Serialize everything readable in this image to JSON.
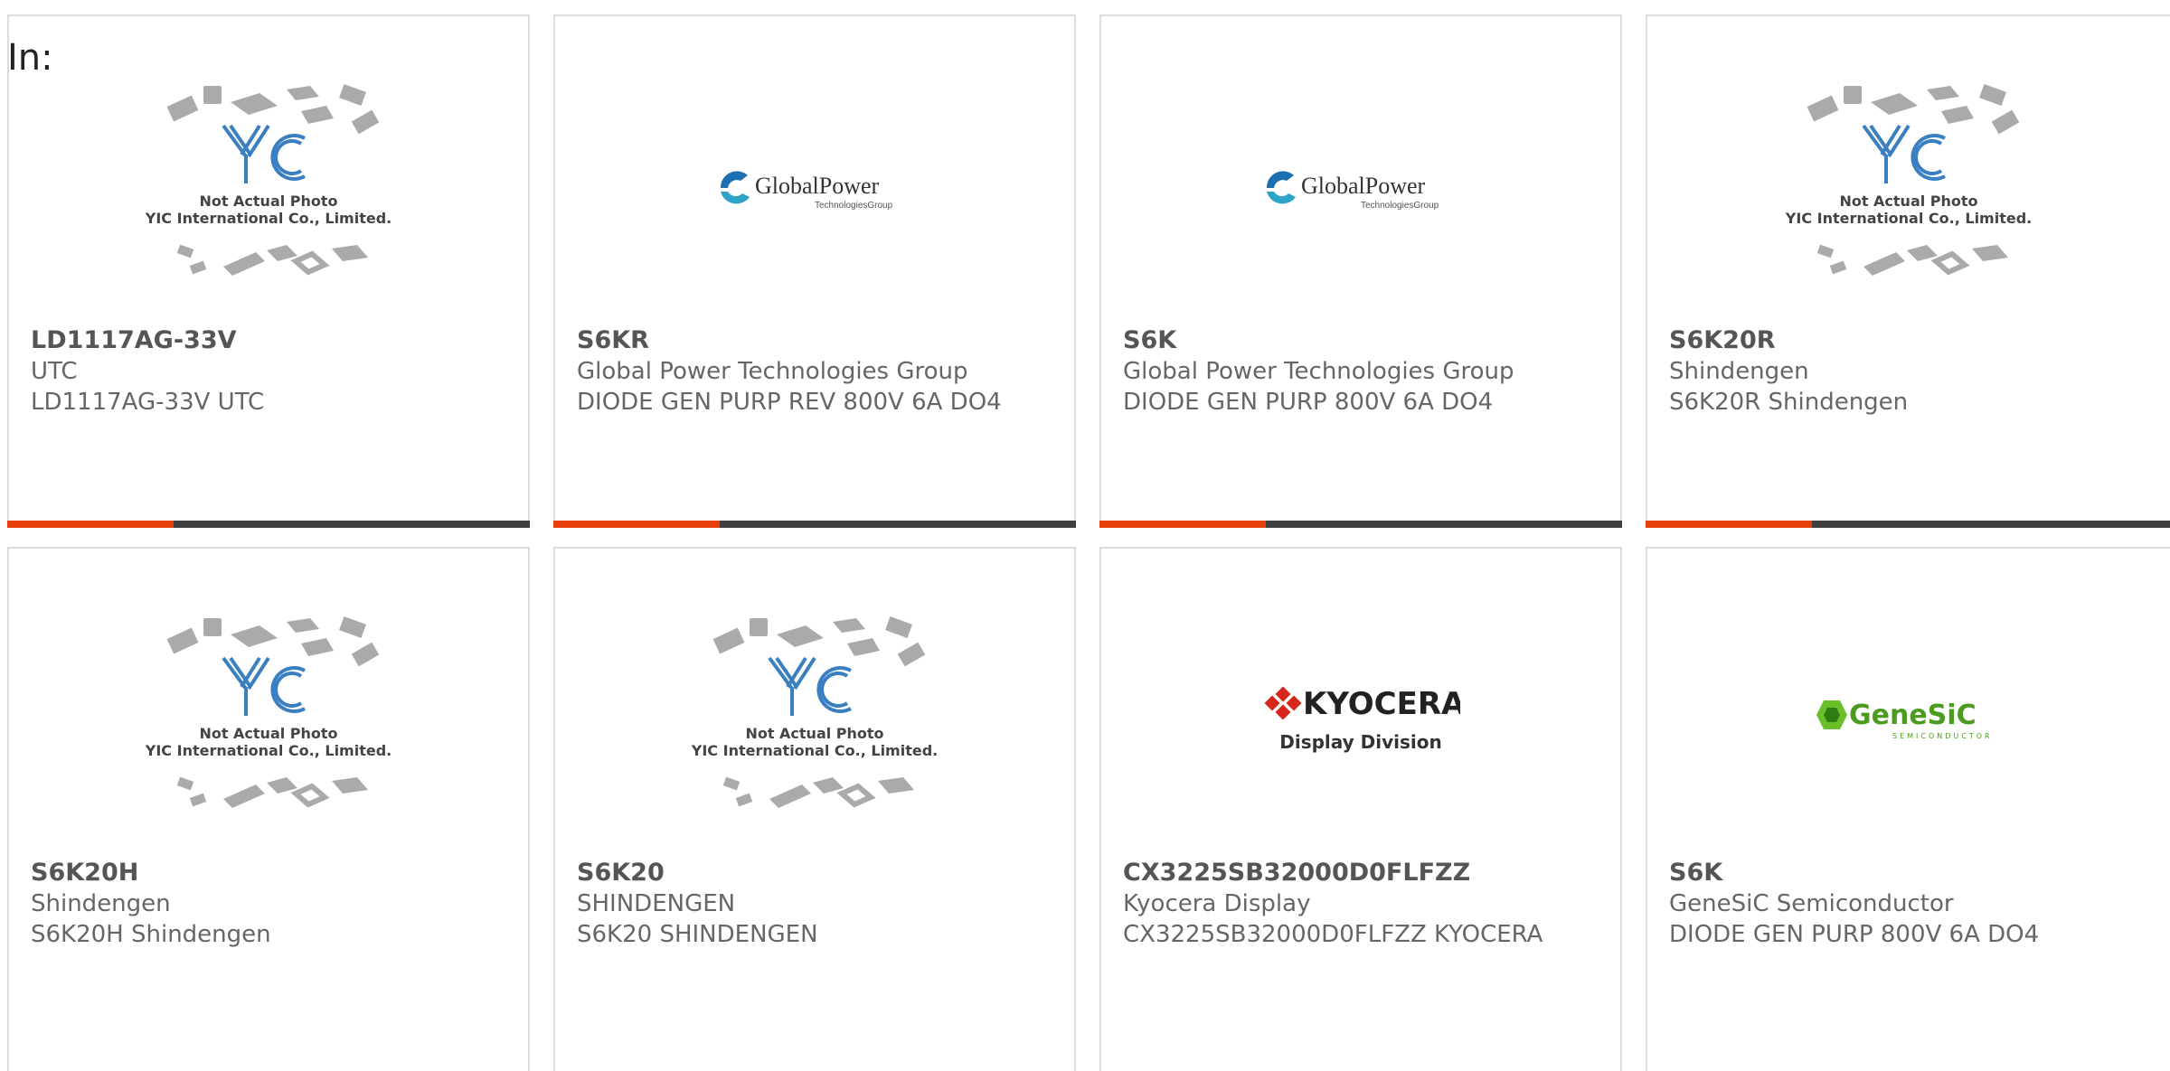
{
  "header_label": "In:",
  "colors": {
    "accent": "#e6400c",
    "bar": "#404040",
    "yic_blue": "#3a7fc0",
    "globalpower_blue": "#1b6fb3",
    "kyocera_red": "#d9261c",
    "genesic_green": "#6abf2a"
  },
  "placeholder_image": {
    "line1": "Not Actual Photo",
    "line2": "YIC International Co., Limited."
  },
  "logos": {
    "globalpower": {
      "name": "GlobalPower",
      "sub": "TechnologiesGroup"
    },
    "kyocera": {
      "name": "KYOCERA",
      "sub": "Display Division"
    },
    "genesic": {
      "name": "GeneSiC",
      "sub": "SEMICONDUCTOR"
    }
  },
  "products": [
    {
      "part": "LD1117AG-33V",
      "manufacturer": "UTC",
      "description": "LD1117AG-33V UTC",
      "image": "yic-placeholder"
    },
    {
      "part": "S6KR",
      "manufacturer": "Global Power Technologies Group",
      "description": "DIODE GEN PURP REV 800V 6A DO4",
      "image": "globalpower-logo"
    },
    {
      "part": "S6K",
      "manufacturer": "Global Power Technologies Group",
      "description": "DIODE GEN PURP 800V 6A DO4",
      "image": "globalpower-logo"
    },
    {
      "part": "S6K20R",
      "manufacturer": "Shindengen",
      "description": "S6K20R Shindengen",
      "image": "yic-placeholder"
    },
    {
      "part": "S6K20H",
      "manufacturer": "Shindengen",
      "description": "S6K20H Shindengen",
      "image": "yic-placeholder"
    },
    {
      "part": "S6K20",
      "manufacturer": "SHINDENGEN",
      "description": "S6K20 SHINDENGEN",
      "image": "yic-placeholder"
    },
    {
      "part": "CX3225SB32000D0FLFZZ",
      "manufacturer": "Kyocera Display",
      "description": "CX3225SB32000D0FLFZZ KYOCERA",
      "image": "kyocera-logo"
    },
    {
      "part": "S6K",
      "manufacturer": "GeneSiC Semiconductor",
      "description": "DIODE GEN PURP 800V 6A DO4",
      "image": "genesic-logo"
    }
  ]
}
